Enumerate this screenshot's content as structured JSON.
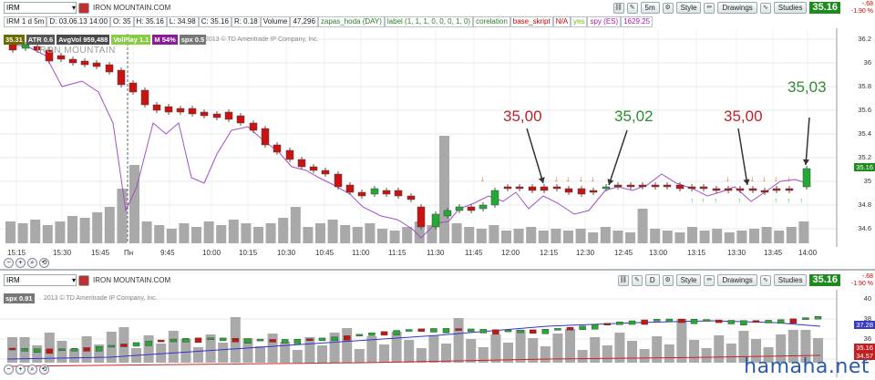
{
  "top_toolbar": {
    "symbol": "IRM",
    "company": "IRON MOUNTAIN.COM",
    "period_button": "5m",
    "style_label": "Style",
    "drawings_label": "Drawings",
    "studies_label": "Studies",
    "last_price": "35.16",
    "change": "-.68",
    "change_pct": "-1.90 %"
  },
  "info_row": {
    "cells": [
      "IRM 1 d 5m",
      "D: 03.06.13 14:00",
      "O: 35",
      "H: 35.16",
      "L: 34.98",
      "C: 35.16",
      "R: 0.18",
      "Volume",
      "47,296",
      "zapas_hoda (DAY)",
      "label (1, 1, 1, 0, 0, 0, 1, 0)",
      "corelation",
      "base_skript",
      "N/A",
      "yes",
      "spy (ES)",
      "1629.25"
    ]
  },
  "studies_row": {
    "items": [
      {
        "text": "35.31",
        "color": "#6b6b00"
      },
      {
        "text": "ATR 0.6",
        "color": "#555555"
      },
      {
        "text": "AvgVol 959,488",
        "color": "#4a4a4a"
      },
      {
        "text": "VolPlay 1.1",
        "color": "#88cc44"
      },
      {
        "text": "M 54%",
        "color": "#8a1a9a"
      },
      {
        "text": "spx 0.5",
        "color": "#777777"
      }
    ],
    "copyright": "2013 © TD Ameritrade IP Company, Inc."
  },
  "upper_chart": {
    "price_labels": [
      "36.2",
      "36",
      "35.8",
      "35.6",
      "35.4",
      "35.2",
      "35",
      "34.8",
      "34.6"
    ],
    "time_labels": [
      "15:15",
      "15:30",
      "15:45",
      "Пн",
      "9:45",
      "10:00",
      "10:15",
      "10:30",
      "10:45",
      "11:00",
      "11:15",
      "11:30",
      "11:45",
      "12:00",
      "12:15",
      "12:30",
      "12:45",
      "13:00",
      "13:15",
      "13:30",
      "13:45",
      "14:00"
    ],
    "current_price_tag": "35.16",
    "annotations": [
      {
        "text": "35,00",
        "color": "#c0202a"
      },
      {
        "text": "35,02",
        "color": "#2e8b2e"
      },
      {
        "text": "35,00",
        "color": "#c0202a"
      },
      {
        "text": "35,03",
        "color": "#2e8b2e"
      }
    ]
  },
  "bottom_toolbar": {
    "symbol": "IRM",
    "company": "IRON MOUNTAIN.COM",
    "period_button": "D",
    "style_label": "Style",
    "drawings_label": "Drawings",
    "studies_label": "Studies",
    "last_price": "35.16",
    "change": "-.68",
    "change_pct": "-1.90 %"
  },
  "lower_chart": {
    "study_tag": "spx 0.91",
    "copyright": "2013 © TD Ameritrade IP Company, Inc.",
    "price_labels": [
      "40",
      "38",
      "36",
      "34"
    ],
    "tag_upper": "37.28",
    "tag_price": "35.16",
    "tag_lower": "34.57"
  },
  "footer": {
    "site": "hamaha.net"
  }
}
